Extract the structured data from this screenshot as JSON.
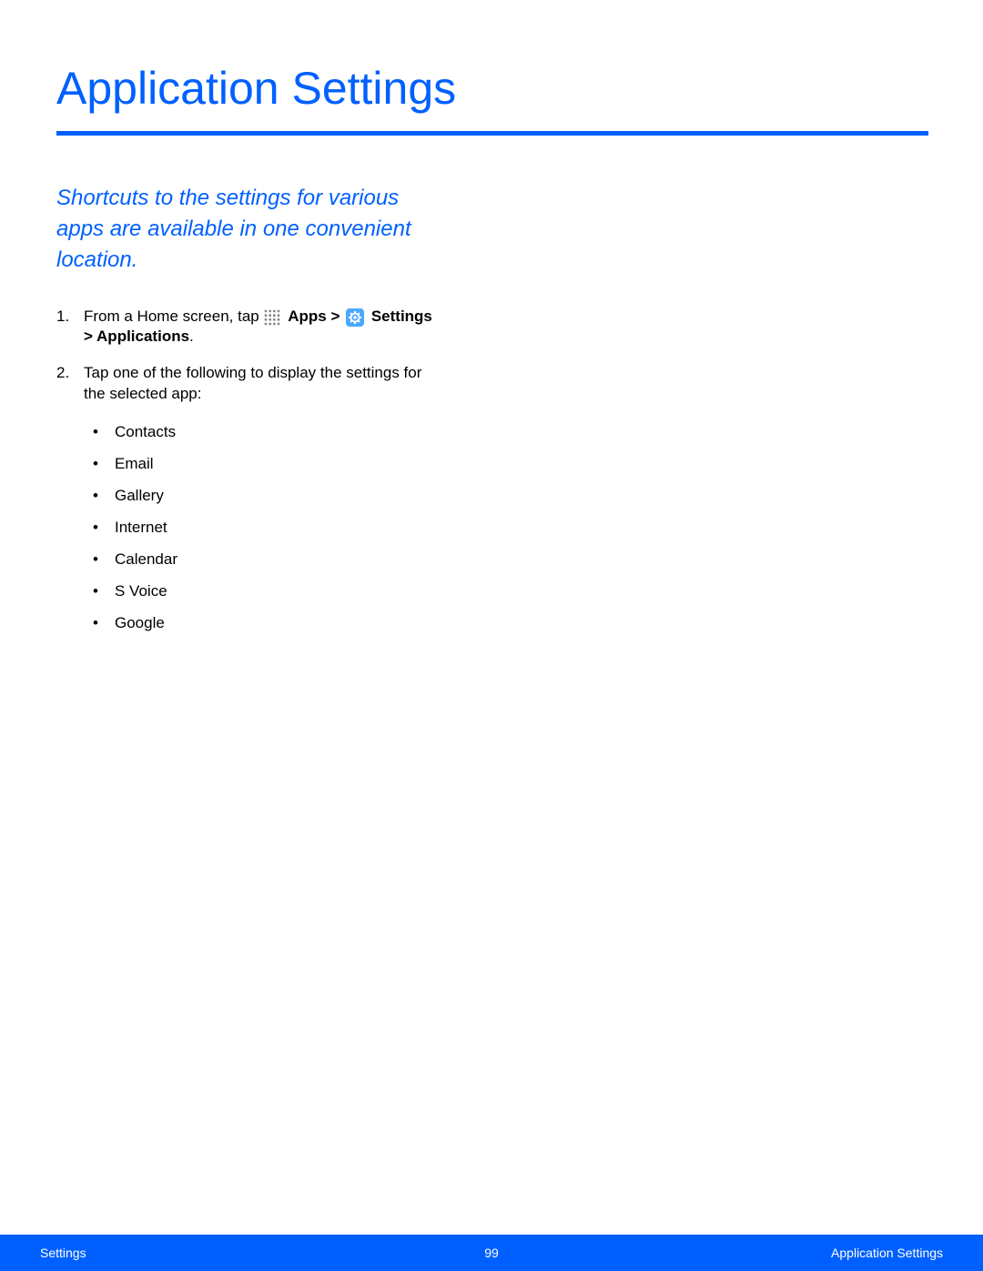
{
  "title": "Application Settings",
  "intro": "Shortcuts to the settings for various apps are available in one convenient location.",
  "step1": {
    "prefix": "From a Home screen, tap",
    "apps_label": "Apps",
    "gt1": " > ",
    "settings_label": "Settings",
    "line2_prefix": "> ",
    "applications_label": "Applications",
    "period": "."
  },
  "step2": {
    "text": "Tap one of the following to display the settings for the selected app:",
    "bullets": {
      "0": "Contacts",
      "1": "Email",
      "2": "Gallery",
      "3": "Internet",
      "4": "Calendar",
      "5": "S Voice",
      "6": "Google"
    }
  },
  "footer": {
    "left": "Settings",
    "center": "99",
    "right": "Application Settings"
  },
  "colors": {
    "accent": "#0060ff"
  }
}
